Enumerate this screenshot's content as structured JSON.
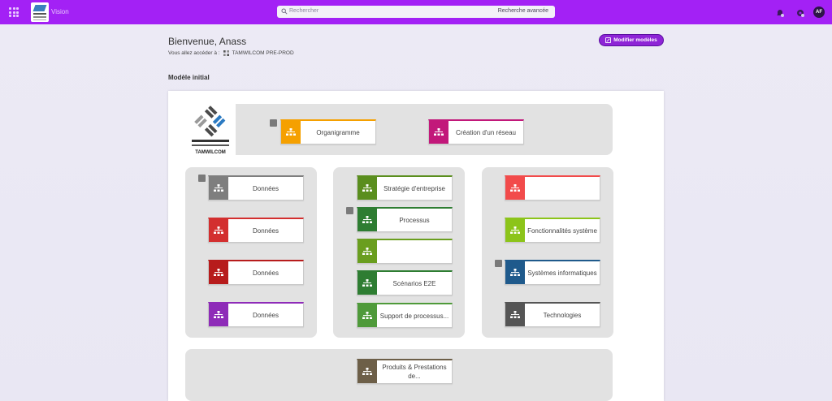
{
  "header": {
    "app_name": "Vision",
    "search_placeholder": "Rechercher",
    "search_advanced": "Recherche avancée",
    "avatar_initials": "AF"
  },
  "welcome": {
    "title": "Bienvenue, Anass",
    "access_label": "Vous allez accéder à :",
    "environment": "TAMWILCOM PRE-PROD"
  },
  "actions": {
    "modify_models": "Modifier modèles"
  },
  "section": {
    "title": "Modèle initial"
  },
  "logo": {
    "brand": "TAMWILCOM"
  },
  "cards": [
    {
      "id": "organigramme",
      "label": "Organigramme",
      "color": "#f5a000"
    },
    {
      "id": "creation-reseau",
      "label": "Création d'un réseau",
      "color": "#c2187a"
    },
    {
      "id": "donnees-1",
      "label": "Données",
      "color": "#7e7e7e"
    },
    {
      "id": "donnees-2",
      "label": "Données",
      "color": "#d32f2f"
    },
    {
      "id": "donnees-3",
      "label": "Données",
      "color": "#b71c1c"
    },
    {
      "id": "donnees-4",
      "label": "Données",
      "color": "#8e2bb8"
    },
    {
      "id": "strategie",
      "label": "Stratégie d'entreprise",
      "color": "#5a8e1e"
    },
    {
      "id": "processus",
      "label": "Processus",
      "color": "#2e7d32"
    },
    {
      "id": "vide-green",
      "label": "",
      "color": "#6a9e1f"
    },
    {
      "id": "scenarios",
      "label": "Scénarios E2E",
      "color": "#2e7d32"
    },
    {
      "id": "support",
      "label": "Support de processus...",
      "color": "#4f9a3a"
    },
    {
      "id": "vide-red",
      "label": "",
      "color": "#f24b4b"
    },
    {
      "id": "fonctionnalites",
      "label": "Fonctionnalités système",
      "color": "#8cc41a"
    },
    {
      "id": "systemes",
      "label": "Systèmes informatiques",
      "color": "#1f5a8c"
    },
    {
      "id": "technologies",
      "label": "Technologies",
      "color": "#555555"
    },
    {
      "id": "produits",
      "label": "Produits & Prestations de...",
      "color": "#6d5f48"
    }
  ]
}
